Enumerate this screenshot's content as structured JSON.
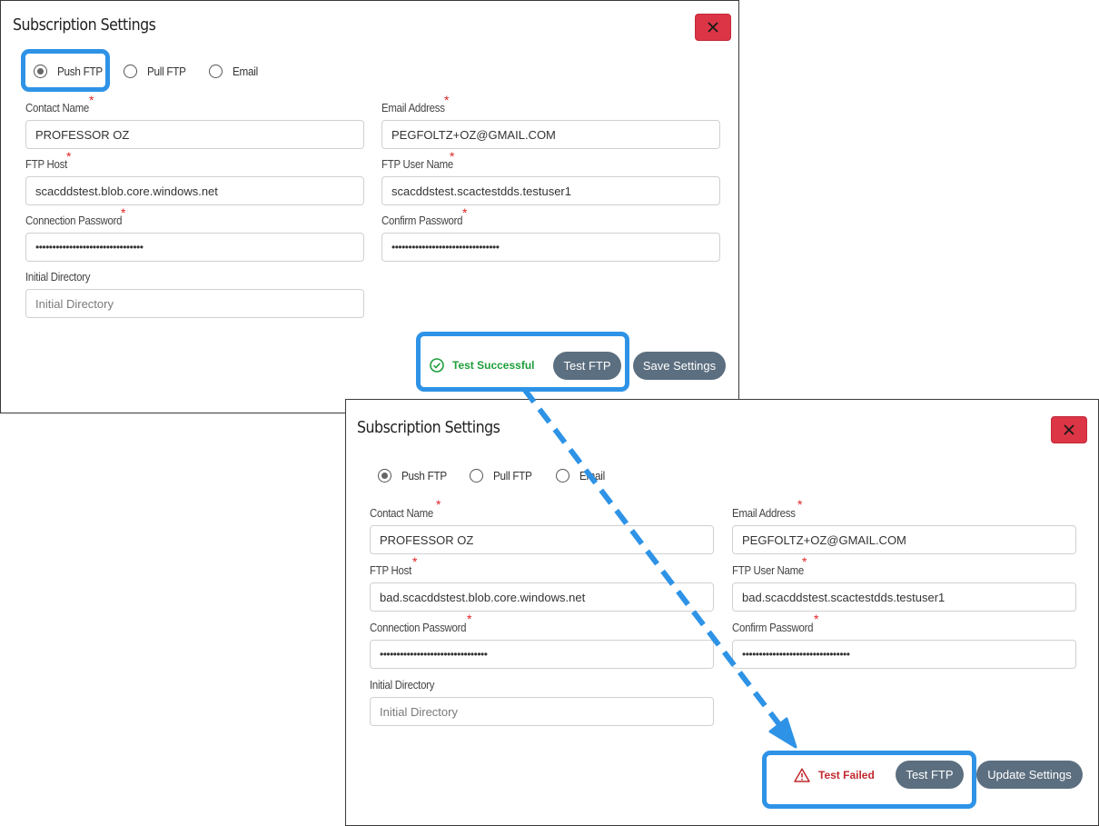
{
  "dialogs": [
    {
      "title": "Subscription Settings",
      "radios": [
        {
          "label": "Push FTP",
          "selected": true
        },
        {
          "label": "Pull FTP",
          "selected": false
        },
        {
          "label": "Email",
          "selected": false
        }
      ],
      "fields": {
        "contact_name": {
          "label": "Contact Name",
          "value": "PROFESSOR OZ"
        },
        "email_address": {
          "label": "Email Address",
          "value": "PEGFOLTZ+OZ@GMAIL.COM"
        },
        "ftp_host": {
          "label": "FTP Host",
          "value": "scacddstest.blob.core.windows.net"
        },
        "ftp_user_name": {
          "label": "FTP User Name",
          "value": "scacddstest.scactestdds.testuser1"
        },
        "connection_password": {
          "label": "Connection Password",
          "value": "••••••••••••••••••••••••••••••••"
        },
        "confirm_password": {
          "label": "Confirm Password",
          "value": "••••••••••••••••••••••••••••••••"
        },
        "initial_directory": {
          "label": "Initial Directory",
          "placeholder": "Initial Directory"
        }
      },
      "status": {
        "text": "Test Successful",
        "color": "#1e9e3a",
        "icon": "check-circle-icon"
      },
      "test_button": "Test FTP",
      "submit_button": "Save Settings"
    },
    {
      "title": "Subscription Settings",
      "radios": [
        {
          "label": "Push FTP",
          "selected": true
        },
        {
          "label": "Pull FTP",
          "selected": false
        },
        {
          "label": "Email",
          "selected": false
        }
      ],
      "fields": {
        "contact_name": {
          "label": "Contact Name",
          "value": "PROFESSOR OZ"
        },
        "email_address": {
          "label": "Email Address",
          "value": "PEGFOLTZ+OZ@GMAIL.COM"
        },
        "ftp_host": {
          "label": "FTP Host",
          "value": "bad.scacddstest.blob.core.windows.net"
        },
        "ftp_user_name": {
          "label": "FTP User Name",
          "value": "bad.scacddstest.scactestdds.testuser1"
        },
        "connection_password": {
          "label": "Connection Password",
          "value": "••••••••••••••••••••••••••••••••"
        },
        "confirm_password": {
          "label": "Confirm Password",
          "value": "••••••••••••••••••••••••••••••••"
        },
        "initial_directory": {
          "label": "Initial Directory",
          "placeholder": "Initial Directory"
        }
      },
      "status": {
        "text": "Test Failed",
        "color": "#c0282d",
        "icon": "warning-triangle-icon"
      },
      "test_button": "Test FTP",
      "submit_button": "Update Settings"
    }
  ],
  "colors": {
    "highlight": "#2e93e6",
    "close_button": "#dc3545",
    "button": "#5c6f80",
    "required_marker": "#e02424"
  }
}
